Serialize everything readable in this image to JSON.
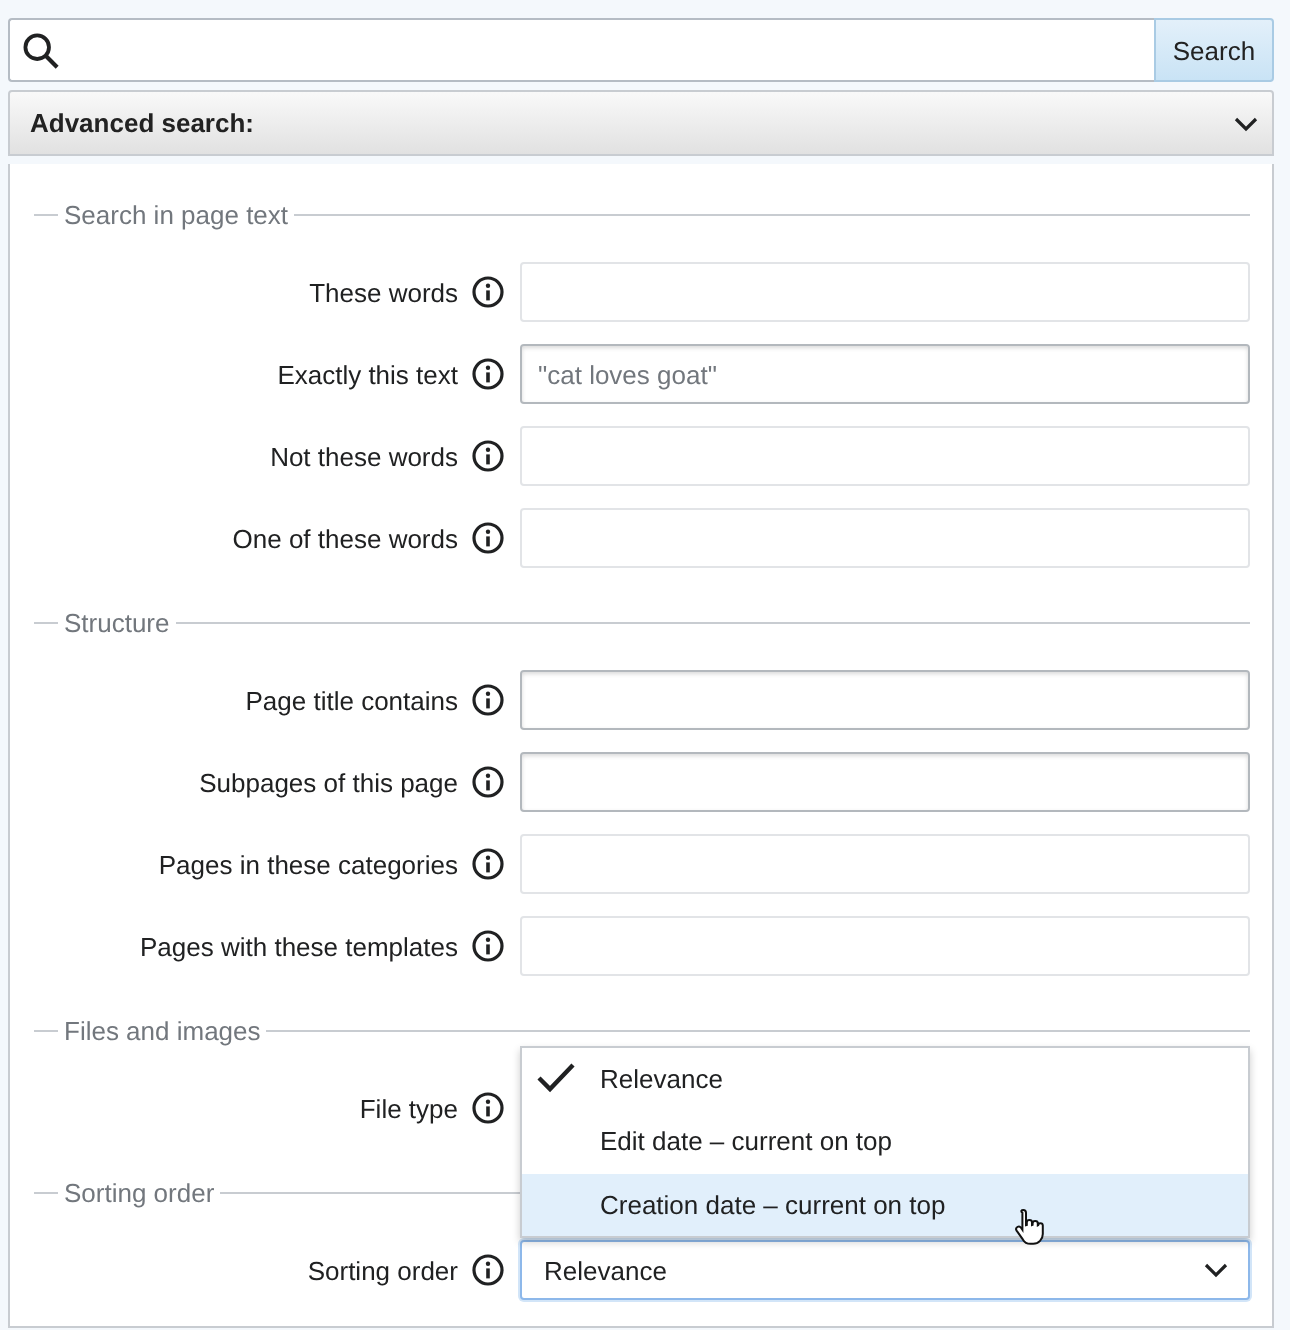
{
  "search": {
    "button": "Search"
  },
  "advanced": {
    "title": "Advanced search:",
    "expanded": true
  },
  "sections": [
    {
      "legend": "Search in page text",
      "rows": [
        {
          "label": "These words",
          "field": {
            "kind": "tags"
          }
        },
        {
          "label": "Exactly this text",
          "field": {
            "kind": "text",
            "placeholder": "\"cat loves goat\""
          }
        },
        {
          "label": "Not these words",
          "field": {
            "kind": "tags"
          }
        },
        {
          "label": "One of these words",
          "field": {
            "kind": "tags"
          }
        }
      ]
    },
    {
      "legend": "Structure",
      "rows": [
        {
          "label": "Page title contains",
          "field": {
            "kind": "text"
          }
        },
        {
          "label": "Subpages of this page",
          "field": {
            "kind": "text"
          }
        },
        {
          "label": "Pages in these categories",
          "field": {
            "kind": "tags"
          }
        },
        {
          "label": "Pages with these templates",
          "field": {
            "kind": "tags"
          }
        }
      ]
    },
    {
      "legend": "Files and images",
      "rows": [
        {
          "label": "File type"
        }
      ]
    },
    {
      "legend": "Sorting order",
      "rows": [
        {
          "label": "Sorting order",
          "field": {
            "kind": "select",
            "value": "Relevance",
            "open": true,
            "options": [
              {
                "label": "Relevance",
                "selected": true,
                "hovered": false
              },
              {
                "label": "Edit date – current on top",
                "selected": false,
                "hovered": false
              },
              {
                "label": "Creation date – current on top",
                "selected": false,
                "hovered": true
              }
            ]
          }
        }
      ]
    }
  ]
}
